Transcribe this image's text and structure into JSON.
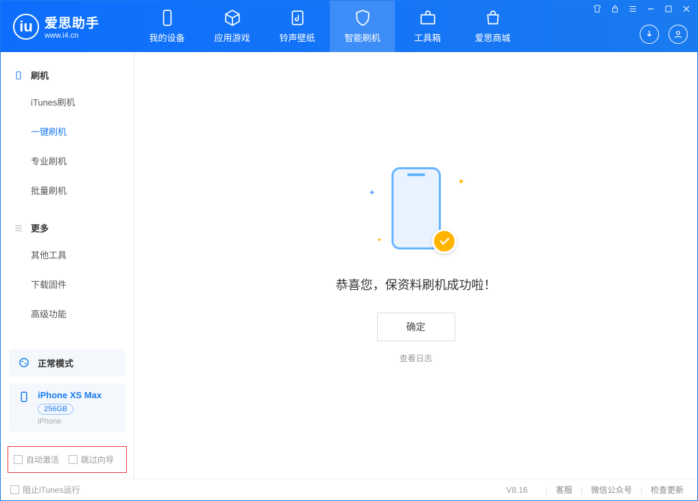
{
  "app": {
    "name": "爱思助手",
    "url": "www.i4.cn"
  },
  "tabs": [
    {
      "label": "我的设备"
    },
    {
      "label": "应用游戏"
    },
    {
      "label": "铃声壁纸"
    },
    {
      "label": "智能刷机"
    },
    {
      "label": "工具箱"
    },
    {
      "label": "爱思商城"
    }
  ],
  "sidebar": {
    "section1": {
      "title": "刷机"
    },
    "items1": [
      {
        "label": "iTunes刷机"
      },
      {
        "label": "一键刷机"
      },
      {
        "label": "专业刷机"
      },
      {
        "label": "批量刷机"
      }
    ],
    "section2": {
      "title": "更多"
    },
    "items2": [
      {
        "label": "其他工具"
      },
      {
        "label": "下载固件"
      },
      {
        "label": "高级功能"
      }
    ]
  },
  "mode_card": {
    "label": "正常模式"
  },
  "device": {
    "name": "iPhone XS Max",
    "storage": "256GB",
    "type": "iPhone"
  },
  "options": {
    "auto_activate": "自动激活",
    "skip_guide": "跳过向导"
  },
  "main": {
    "success_msg": "恭喜您，保资料刷机成功啦！",
    "ok": "确定",
    "view_log": "查看日志"
  },
  "footer": {
    "block_itunes": "阻止iTunes运行",
    "version": "V8.16",
    "links": [
      "客服",
      "微信公众号",
      "检查更新"
    ]
  }
}
